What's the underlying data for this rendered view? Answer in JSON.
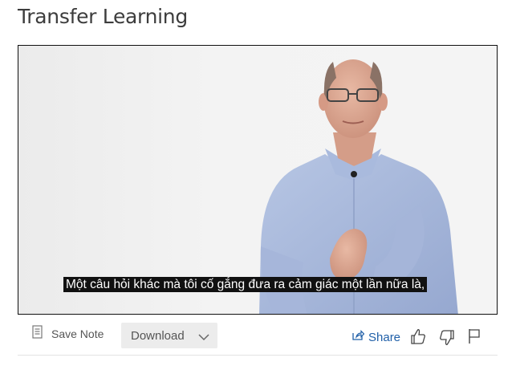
{
  "page": {
    "title": "Transfer Learning"
  },
  "video": {
    "subtitle": "Một câu hỏi khác mà tôi cố gắng đưa ra cảm giác một lần nữa là,"
  },
  "toolbar": {
    "save_note_label": "Save Note",
    "download_label": "Download",
    "share_label": "Share"
  },
  "icons": {
    "save_note": "note-icon",
    "download_chevron": "chevron-down-icon",
    "share": "share-icon",
    "like": "thumbs-up-icon",
    "dislike": "thumbs-down-icon",
    "flag": "flag-icon"
  },
  "colors": {
    "share_link": "#1f5fa8",
    "subtitle_bg": "#111111"
  }
}
